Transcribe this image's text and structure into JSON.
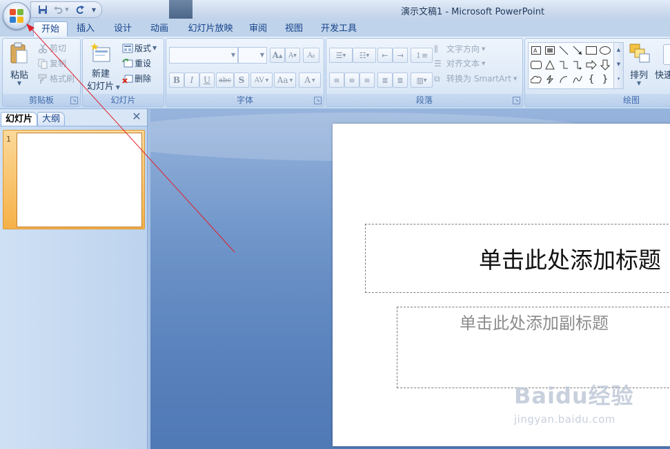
{
  "window": {
    "title": "演示文稿1 - Microsoft PowerPoint"
  },
  "quick_access": {
    "icons": [
      "save-icon",
      "undo-icon",
      "redo-icon",
      "customize-icon"
    ]
  },
  "ribbon_tabs": [
    {
      "label": "开始",
      "active": true
    },
    {
      "label": "插入"
    },
    {
      "label": "设计"
    },
    {
      "label": "动画"
    },
    {
      "label": "幻灯片放映"
    },
    {
      "label": "审阅"
    },
    {
      "label": "视图"
    },
    {
      "label": "开发工具"
    }
  ],
  "groups": {
    "clipboard": {
      "label": "剪贴板",
      "paste": "粘贴",
      "cut": "剪切",
      "copy": "复制",
      "format_painter": "格式刷"
    },
    "slides": {
      "label": "幻灯片",
      "new_slide_line1": "新建",
      "new_slide_line2": "幻灯片",
      "layout": "版式",
      "reset": "重设",
      "delete": "删除"
    },
    "font": {
      "label": "字体",
      "bold": "B",
      "italic": "I",
      "underline": "U",
      "strike": "abc",
      "shadow": "S",
      "spacing": "AV",
      "case": "Aa",
      "color": "A",
      "grow": "A",
      "shrink": "A"
    },
    "paragraph": {
      "label": "段落",
      "text_direction": "文字方向",
      "align_text": "对齐文本",
      "smartart": "转换为 SmartArt"
    },
    "drawing": {
      "label": "绘图",
      "arrange": "排列",
      "quick_styles": "快速"
    }
  },
  "pane": {
    "tab_slides": "幻灯片",
    "tab_outline": "大纲",
    "slide_number": "1"
  },
  "slide": {
    "title_placeholder": "单击此处添加标题",
    "subtitle_placeholder": "单击此处添加副标题"
  },
  "watermark": {
    "logo": "Baidu经验",
    "url": "jingyan.baidu.com"
  },
  "colors": {
    "ribbon_text": "#1e395b",
    "tab_text": "#15428b",
    "annotation_arrow": "#e0202a",
    "thumb_selected": "#f6b148"
  }
}
